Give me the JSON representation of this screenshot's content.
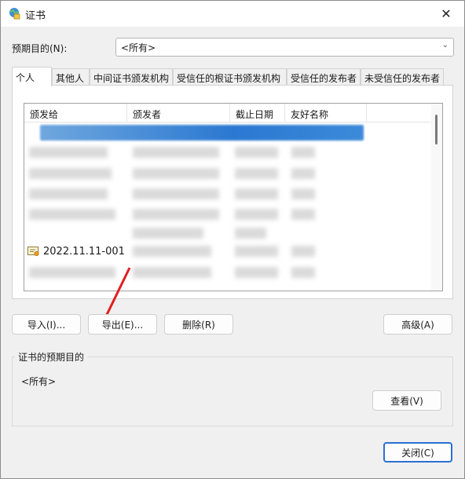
{
  "window": {
    "title": "证书",
    "close_glyph": "✕"
  },
  "purpose": {
    "label": "预期目的(N):",
    "value": "<所有>"
  },
  "tabs": [
    {
      "label": "个人",
      "active": true
    },
    {
      "label": "其他人",
      "active": false
    },
    {
      "label": "中间证书颁发机构",
      "active": false
    },
    {
      "label": "受信任的根证书颁发机构",
      "active": false
    },
    {
      "label": "受信任的发布者",
      "active": false
    },
    {
      "label": "未受信任的发布者",
      "active": false
    }
  ],
  "list": {
    "columns": [
      "颁发给",
      "颁发者",
      "截止日期",
      "友好名称"
    ],
    "visible_cert_name": "2022.11.11-001"
  },
  "buttons": {
    "import": "导入(I)...",
    "export": "导出(E)...",
    "delete": "删除(R)",
    "advanced": "高级(A)",
    "view": "查看(V)",
    "close": "关闭(C)"
  },
  "purpose_group": {
    "title": "证书的预期目的",
    "value": "<所有>"
  },
  "colors": {
    "selection": "#2a78d1",
    "arrow": "#e02020",
    "primary_border": "#2c6fd3"
  },
  "icons": {
    "title": "cert-globe-icon",
    "row": "certificate-icon"
  }
}
